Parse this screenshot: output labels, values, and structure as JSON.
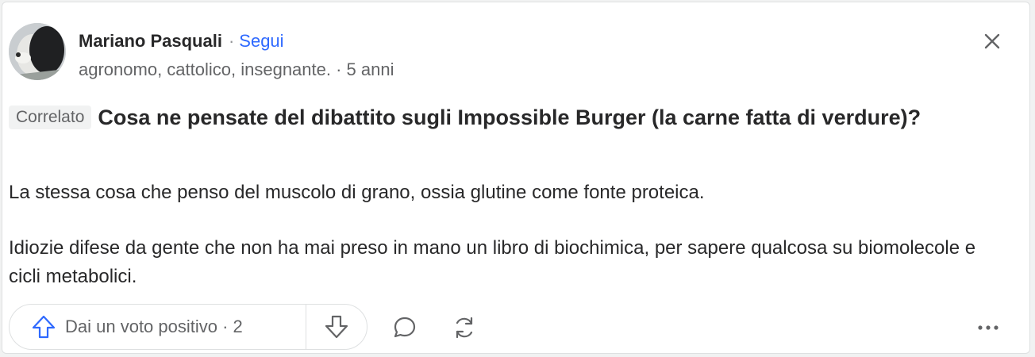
{
  "author": {
    "name": "Mariano Pasquali",
    "separator": "·",
    "follow_label": "Segui",
    "credential": "agronomo, cattolico, insegnante. · 5 anni"
  },
  "question": {
    "tag": "Correlato",
    "title": "Cosa ne pensate del dibattito sugli Impossible Burger (la carne fatta di verdure)?"
  },
  "answer": {
    "paragraphs": [
      "La stessa cosa che penso del muscolo di grano, ossia glutine come fonte proteica.",
      "Idiozie difese da gente che non ha mai preso in mano un libro di biochimica, per sapere qualcosa su biomolecole e cicli metabolici."
    ]
  },
  "actions": {
    "upvote_label": "Dai un voto positivo · 2"
  },
  "icons": {
    "close": "close-icon",
    "upvote": "arrow-up-icon",
    "downvote": "arrow-down-icon",
    "comment": "comment-icon",
    "share": "share-icon",
    "more": "more-icon"
  },
  "colors": {
    "accent": "#2e69ff",
    "text": "#282829",
    "muted": "#636466"
  }
}
